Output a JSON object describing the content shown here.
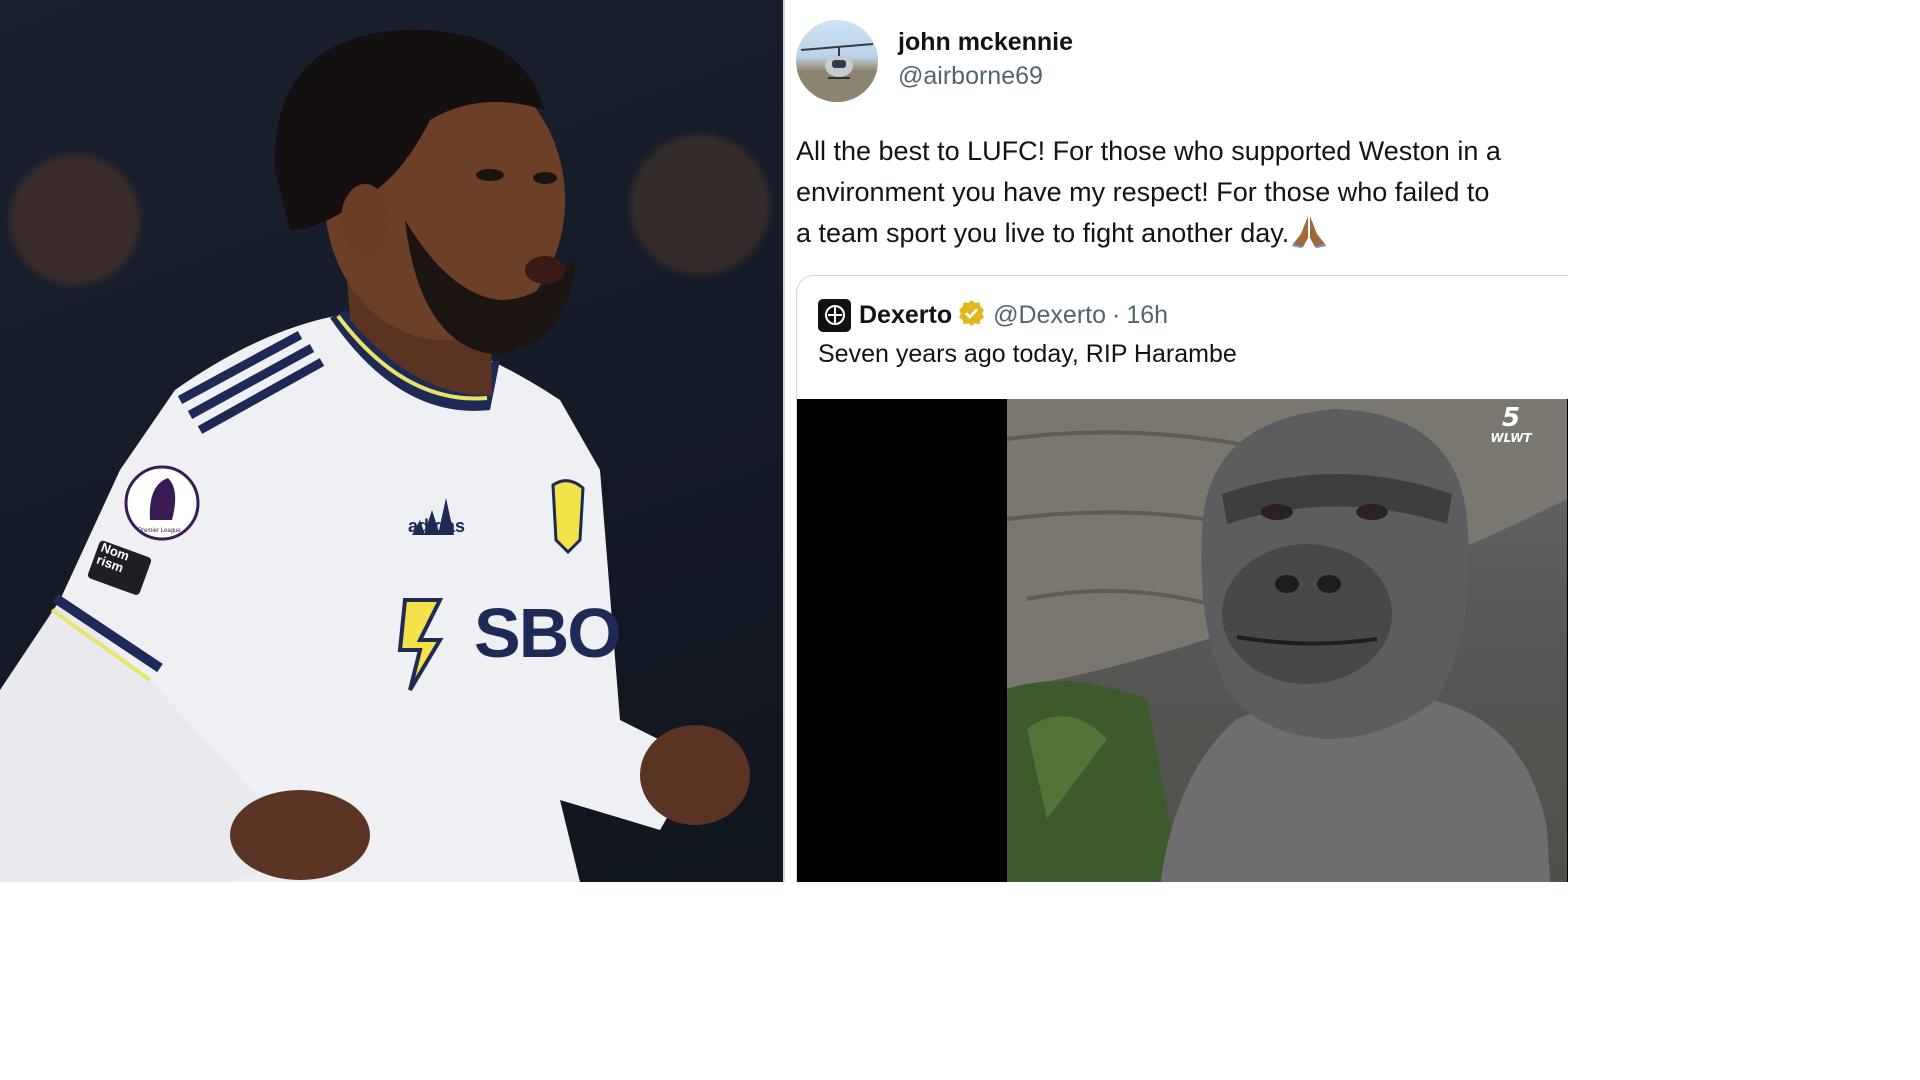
{
  "left_photo": {
    "jersey_brand": "adidas",
    "sponsor_text": "SBO",
    "sleeve_patch": "Nom\nrism",
    "badge_text": "Premier League"
  },
  "tweet": {
    "author_name": "john mckennie",
    "author_handle": "@airborne69",
    "text_lines": [
      "All the best to LUFC! For those who supported Weston in a",
      "environment you have my respect! For those who failed to",
      "a team sport you live to fight another day."
    ],
    "emoji_icon": "folded-hands-icon"
  },
  "quote": {
    "name": "Dexerto",
    "handle": "@Dexerto",
    "separator": "·",
    "time": "16h",
    "text": "Seven years ago today, RIP Harambe",
    "verified_icon": "verified-badge-icon",
    "media_logo_number": "5",
    "media_logo_text": "WLWT"
  },
  "colors": {
    "text_primary": "#0f1419",
    "text_secondary": "#536471",
    "border": "#cfd9de",
    "verified_gold": "#e2b719"
  }
}
